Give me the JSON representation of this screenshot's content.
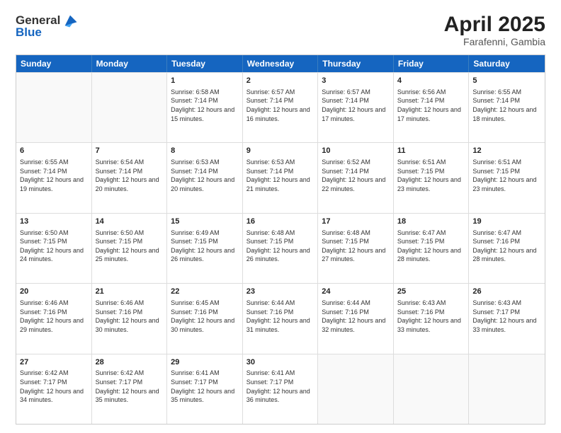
{
  "header": {
    "logo": {
      "general": "General",
      "blue": "Blue"
    },
    "title": "April 2025",
    "location": "Farafenni, Gambia"
  },
  "calendar": {
    "days": [
      "Sunday",
      "Monday",
      "Tuesday",
      "Wednesday",
      "Thursday",
      "Friday",
      "Saturday"
    ],
    "rows": [
      [
        {
          "day": "",
          "sunrise": "",
          "sunset": "",
          "daylight": ""
        },
        {
          "day": "",
          "sunrise": "",
          "sunset": "",
          "daylight": ""
        },
        {
          "day": "1",
          "sunrise": "Sunrise: 6:58 AM",
          "sunset": "Sunset: 7:14 PM",
          "daylight": "Daylight: 12 hours and 15 minutes."
        },
        {
          "day": "2",
          "sunrise": "Sunrise: 6:57 AM",
          "sunset": "Sunset: 7:14 PM",
          "daylight": "Daylight: 12 hours and 16 minutes."
        },
        {
          "day": "3",
          "sunrise": "Sunrise: 6:57 AM",
          "sunset": "Sunset: 7:14 PM",
          "daylight": "Daylight: 12 hours and 17 minutes."
        },
        {
          "day": "4",
          "sunrise": "Sunrise: 6:56 AM",
          "sunset": "Sunset: 7:14 PM",
          "daylight": "Daylight: 12 hours and 17 minutes."
        },
        {
          "day": "5",
          "sunrise": "Sunrise: 6:55 AM",
          "sunset": "Sunset: 7:14 PM",
          "daylight": "Daylight: 12 hours and 18 minutes."
        }
      ],
      [
        {
          "day": "6",
          "sunrise": "Sunrise: 6:55 AM",
          "sunset": "Sunset: 7:14 PM",
          "daylight": "Daylight: 12 hours and 19 minutes."
        },
        {
          "day": "7",
          "sunrise": "Sunrise: 6:54 AM",
          "sunset": "Sunset: 7:14 PM",
          "daylight": "Daylight: 12 hours and 20 minutes."
        },
        {
          "day": "8",
          "sunrise": "Sunrise: 6:53 AM",
          "sunset": "Sunset: 7:14 PM",
          "daylight": "Daylight: 12 hours and 20 minutes."
        },
        {
          "day": "9",
          "sunrise": "Sunrise: 6:53 AM",
          "sunset": "Sunset: 7:14 PM",
          "daylight": "Daylight: 12 hours and 21 minutes."
        },
        {
          "day": "10",
          "sunrise": "Sunrise: 6:52 AM",
          "sunset": "Sunset: 7:14 PM",
          "daylight": "Daylight: 12 hours and 22 minutes."
        },
        {
          "day": "11",
          "sunrise": "Sunrise: 6:51 AM",
          "sunset": "Sunset: 7:15 PM",
          "daylight": "Daylight: 12 hours and 23 minutes."
        },
        {
          "day": "12",
          "sunrise": "Sunrise: 6:51 AM",
          "sunset": "Sunset: 7:15 PM",
          "daylight": "Daylight: 12 hours and 23 minutes."
        }
      ],
      [
        {
          "day": "13",
          "sunrise": "Sunrise: 6:50 AM",
          "sunset": "Sunset: 7:15 PM",
          "daylight": "Daylight: 12 hours and 24 minutes."
        },
        {
          "day": "14",
          "sunrise": "Sunrise: 6:50 AM",
          "sunset": "Sunset: 7:15 PM",
          "daylight": "Daylight: 12 hours and 25 minutes."
        },
        {
          "day": "15",
          "sunrise": "Sunrise: 6:49 AM",
          "sunset": "Sunset: 7:15 PM",
          "daylight": "Daylight: 12 hours and 26 minutes."
        },
        {
          "day": "16",
          "sunrise": "Sunrise: 6:48 AM",
          "sunset": "Sunset: 7:15 PM",
          "daylight": "Daylight: 12 hours and 26 minutes."
        },
        {
          "day": "17",
          "sunrise": "Sunrise: 6:48 AM",
          "sunset": "Sunset: 7:15 PM",
          "daylight": "Daylight: 12 hours and 27 minutes."
        },
        {
          "day": "18",
          "sunrise": "Sunrise: 6:47 AM",
          "sunset": "Sunset: 7:15 PM",
          "daylight": "Daylight: 12 hours and 28 minutes."
        },
        {
          "day": "19",
          "sunrise": "Sunrise: 6:47 AM",
          "sunset": "Sunset: 7:16 PM",
          "daylight": "Daylight: 12 hours and 28 minutes."
        }
      ],
      [
        {
          "day": "20",
          "sunrise": "Sunrise: 6:46 AM",
          "sunset": "Sunset: 7:16 PM",
          "daylight": "Daylight: 12 hours and 29 minutes."
        },
        {
          "day": "21",
          "sunrise": "Sunrise: 6:46 AM",
          "sunset": "Sunset: 7:16 PM",
          "daylight": "Daylight: 12 hours and 30 minutes."
        },
        {
          "day": "22",
          "sunrise": "Sunrise: 6:45 AM",
          "sunset": "Sunset: 7:16 PM",
          "daylight": "Daylight: 12 hours and 30 minutes."
        },
        {
          "day": "23",
          "sunrise": "Sunrise: 6:44 AM",
          "sunset": "Sunset: 7:16 PM",
          "daylight": "Daylight: 12 hours and 31 minutes."
        },
        {
          "day": "24",
          "sunrise": "Sunrise: 6:44 AM",
          "sunset": "Sunset: 7:16 PM",
          "daylight": "Daylight: 12 hours and 32 minutes."
        },
        {
          "day": "25",
          "sunrise": "Sunrise: 6:43 AM",
          "sunset": "Sunset: 7:16 PM",
          "daylight": "Daylight: 12 hours and 33 minutes."
        },
        {
          "day": "26",
          "sunrise": "Sunrise: 6:43 AM",
          "sunset": "Sunset: 7:17 PM",
          "daylight": "Daylight: 12 hours and 33 minutes."
        }
      ],
      [
        {
          "day": "27",
          "sunrise": "Sunrise: 6:42 AM",
          "sunset": "Sunset: 7:17 PM",
          "daylight": "Daylight: 12 hours and 34 minutes."
        },
        {
          "day": "28",
          "sunrise": "Sunrise: 6:42 AM",
          "sunset": "Sunset: 7:17 PM",
          "daylight": "Daylight: 12 hours and 35 minutes."
        },
        {
          "day": "29",
          "sunrise": "Sunrise: 6:41 AM",
          "sunset": "Sunset: 7:17 PM",
          "daylight": "Daylight: 12 hours and 35 minutes."
        },
        {
          "day": "30",
          "sunrise": "Sunrise: 6:41 AM",
          "sunset": "Sunset: 7:17 PM",
          "daylight": "Daylight: 12 hours and 36 minutes."
        },
        {
          "day": "",
          "sunrise": "",
          "sunset": "",
          "daylight": ""
        },
        {
          "day": "",
          "sunrise": "",
          "sunset": "",
          "daylight": ""
        },
        {
          "day": "",
          "sunrise": "",
          "sunset": "",
          "daylight": ""
        }
      ]
    ]
  }
}
